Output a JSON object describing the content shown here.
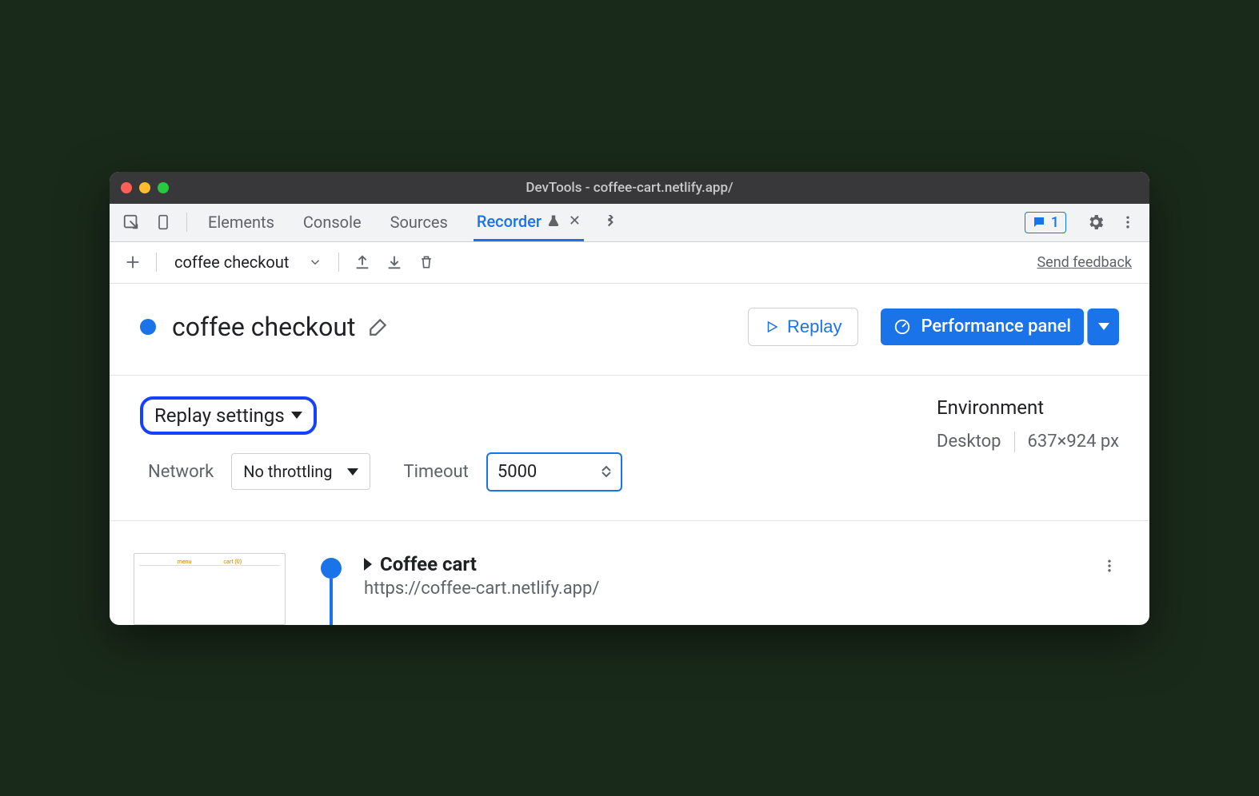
{
  "window": {
    "title": "DevTools - coffee-cart.netlify.app/"
  },
  "tabs": {
    "items": [
      "Elements",
      "Console",
      "Sources",
      "Recorder"
    ],
    "active": "Recorder"
  },
  "issues": {
    "count": "1"
  },
  "toolbar": {
    "recording_name": "coffee checkout",
    "feedback": "Send feedback"
  },
  "header": {
    "title": "coffee checkout",
    "replay_label": "Replay",
    "perf_label": "Performance panel"
  },
  "settings": {
    "replay_settings_label": "Replay settings",
    "network_label": "Network",
    "network_value": "No throttling",
    "timeout_label": "Timeout",
    "timeout_value": "5000",
    "env_title": "Environment",
    "env_device": "Desktop",
    "env_dims": "637×924 px"
  },
  "step": {
    "title": "Coffee cart",
    "url": "https://coffee-cart.netlify.app/"
  }
}
